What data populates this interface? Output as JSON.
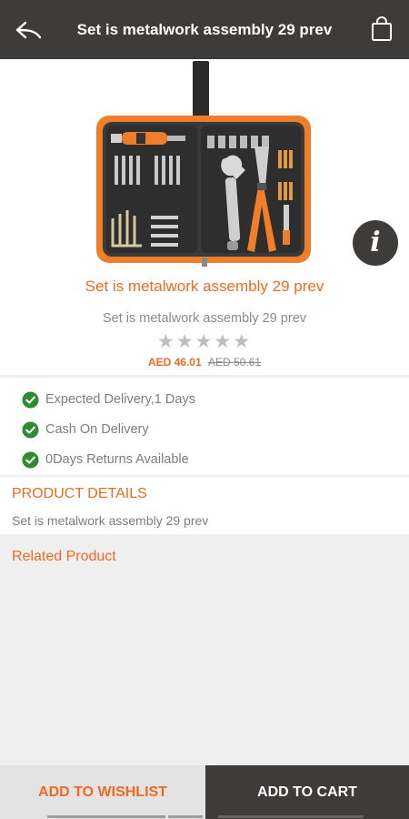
{
  "header": {
    "title": "Set is metalwork assembly 29 prev",
    "back_icon": "back-arrow-icon",
    "cart_icon": "shopping-bag-icon"
  },
  "product": {
    "name": "Set is metalwork assembly 29 prev",
    "subtitle": "Set is metalwork assembly 29 prev",
    "rating_stars": "★★★★★",
    "rating_value": 0,
    "price_now": "AED 46.01",
    "price_old": "AED 50.61"
  },
  "actions": {
    "info_icon": "info-icon",
    "share_icon": "share-icon"
  },
  "features": [
    {
      "label": "Expected Delivery,1 Days"
    },
    {
      "label": "Cash On Delivery"
    },
    {
      "label": "0Days Returns Available"
    }
  ],
  "details": {
    "heading": "PRODUCT DETAILS",
    "body": "Set is metalwork assembly 29 prev"
  },
  "related": {
    "heading": "Related Product"
  },
  "bottom": {
    "wishlist_label": "ADD TO WISHLIST",
    "cart_label": "ADD TO CART"
  },
  "colors": {
    "accent": "#ef6a21",
    "bar": "#3e3b3b",
    "check": "#2e8b2e"
  }
}
